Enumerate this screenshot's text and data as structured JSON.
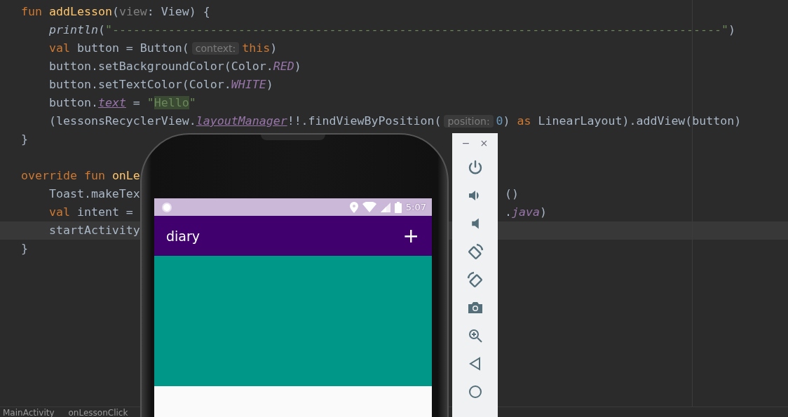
{
  "editor": {
    "lines": [
      {
        "tokens": [
          {
            "kind": "kw",
            "text": "fun"
          },
          {
            "kind": "fn",
            "text": " addLesson"
          },
          {
            "kind": "plain",
            "text": "("
          },
          {
            "kind": "unused",
            "text": "view"
          },
          {
            "kind": "plain",
            "text": ": View) {"
          }
        ]
      },
      {
        "tokens": [
          {
            "kind": "call",
            "text": "    println"
          },
          {
            "kind": "plain",
            "text": "("
          },
          {
            "kind": "str",
            "text": "\"---------------------------------------------------------------------------------------\""
          },
          {
            "kind": "plain",
            "text": ")"
          }
        ]
      },
      {
        "tokens": [
          {
            "kind": "kw",
            "text": "    val"
          },
          {
            "kind": "plain",
            "text": " button = Button("
          },
          {
            "kind": "hint",
            "text": "context:"
          },
          {
            "kind": "kw",
            "text": "this"
          },
          {
            "kind": "plain",
            "text": ")"
          }
        ]
      },
      {
        "tokens": [
          {
            "kind": "plain",
            "text": "    button.setBackgroundColor(Color."
          },
          {
            "kind": "prop",
            "text": "RED"
          },
          {
            "kind": "plain",
            "text": ")"
          }
        ]
      },
      {
        "tokens": [
          {
            "kind": "plain",
            "text": "    button.setTextColor(Color."
          },
          {
            "kind": "prop",
            "text": "WHITE"
          },
          {
            "kind": "plain",
            "text": ")"
          }
        ]
      },
      {
        "tokens": [
          {
            "kind": "plain",
            "text": "    button."
          },
          {
            "kind": "synth",
            "text": "text"
          },
          {
            "kind": "plain",
            "text": " = "
          },
          {
            "kind": "str",
            "text": "\""
          },
          {
            "kind": "match",
            "text": "Hello"
          },
          {
            "kind": "str",
            "text": "\""
          }
        ]
      },
      {
        "tokens": [
          {
            "kind": "plain",
            "text": "    (lessonsRecyclerView."
          },
          {
            "kind": "synth",
            "text": "layoutManager"
          },
          {
            "kind": "plain",
            "text": "!!.findViewByPosition("
          },
          {
            "kind": "hint",
            "text": "position:"
          },
          {
            "kind": "num",
            "text": "0"
          },
          {
            "kind": "plain",
            "text": ") "
          },
          {
            "kind": "kw",
            "text": "as"
          },
          {
            "kind": "plain",
            "text": " LinearLayout).addView(button)"
          }
        ]
      },
      {
        "tokens": [
          {
            "kind": "plain",
            "text": "}"
          }
        ]
      }
    ],
    "lower_lines": [
      {
        "current": false
      },
      {
        "current": false,
        "tokens": [
          {
            "kind": "kw",
            "text": "override fun"
          },
          {
            "kind": "fn",
            "text": " onLe"
          }
        ]
      },
      {
        "current": false,
        "tokens": [
          {
            "kind": "plain",
            "text": "    Toast.makeTex"
          }
        ],
        "right_tokens": [
          {
            "kind": "plain",
            "text": "()"
          }
        ]
      },
      {
        "current": false,
        "tokens": [
          {
            "kind": "kw",
            "text": "    val"
          },
          {
            "kind": "plain",
            "text": " intent = "
          }
        ],
        "right_tokens": [
          {
            "kind": "plain",
            "text": "."
          },
          {
            "kind": "prop",
            "text": "java"
          },
          {
            "kind": "plain",
            "text": ")"
          }
        ]
      },
      {
        "current": true,
        "tokens": [
          {
            "kind": "plain",
            "text": "    startActivity"
          }
        ]
      },
      {
        "current": false,
        "tokens": [
          {
            "kind": "plain",
            "text": "}"
          }
        ]
      }
    ],
    "breadcrumbs": [
      "MainActivity",
      "onLessonClick"
    ]
  },
  "emulator": {
    "status_bar": {
      "time": "5:07"
    },
    "app_bar": {
      "title": "diary",
      "action": "+"
    },
    "toolbar": {
      "window_buttons": [
        "−",
        "×"
      ]
    }
  }
}
